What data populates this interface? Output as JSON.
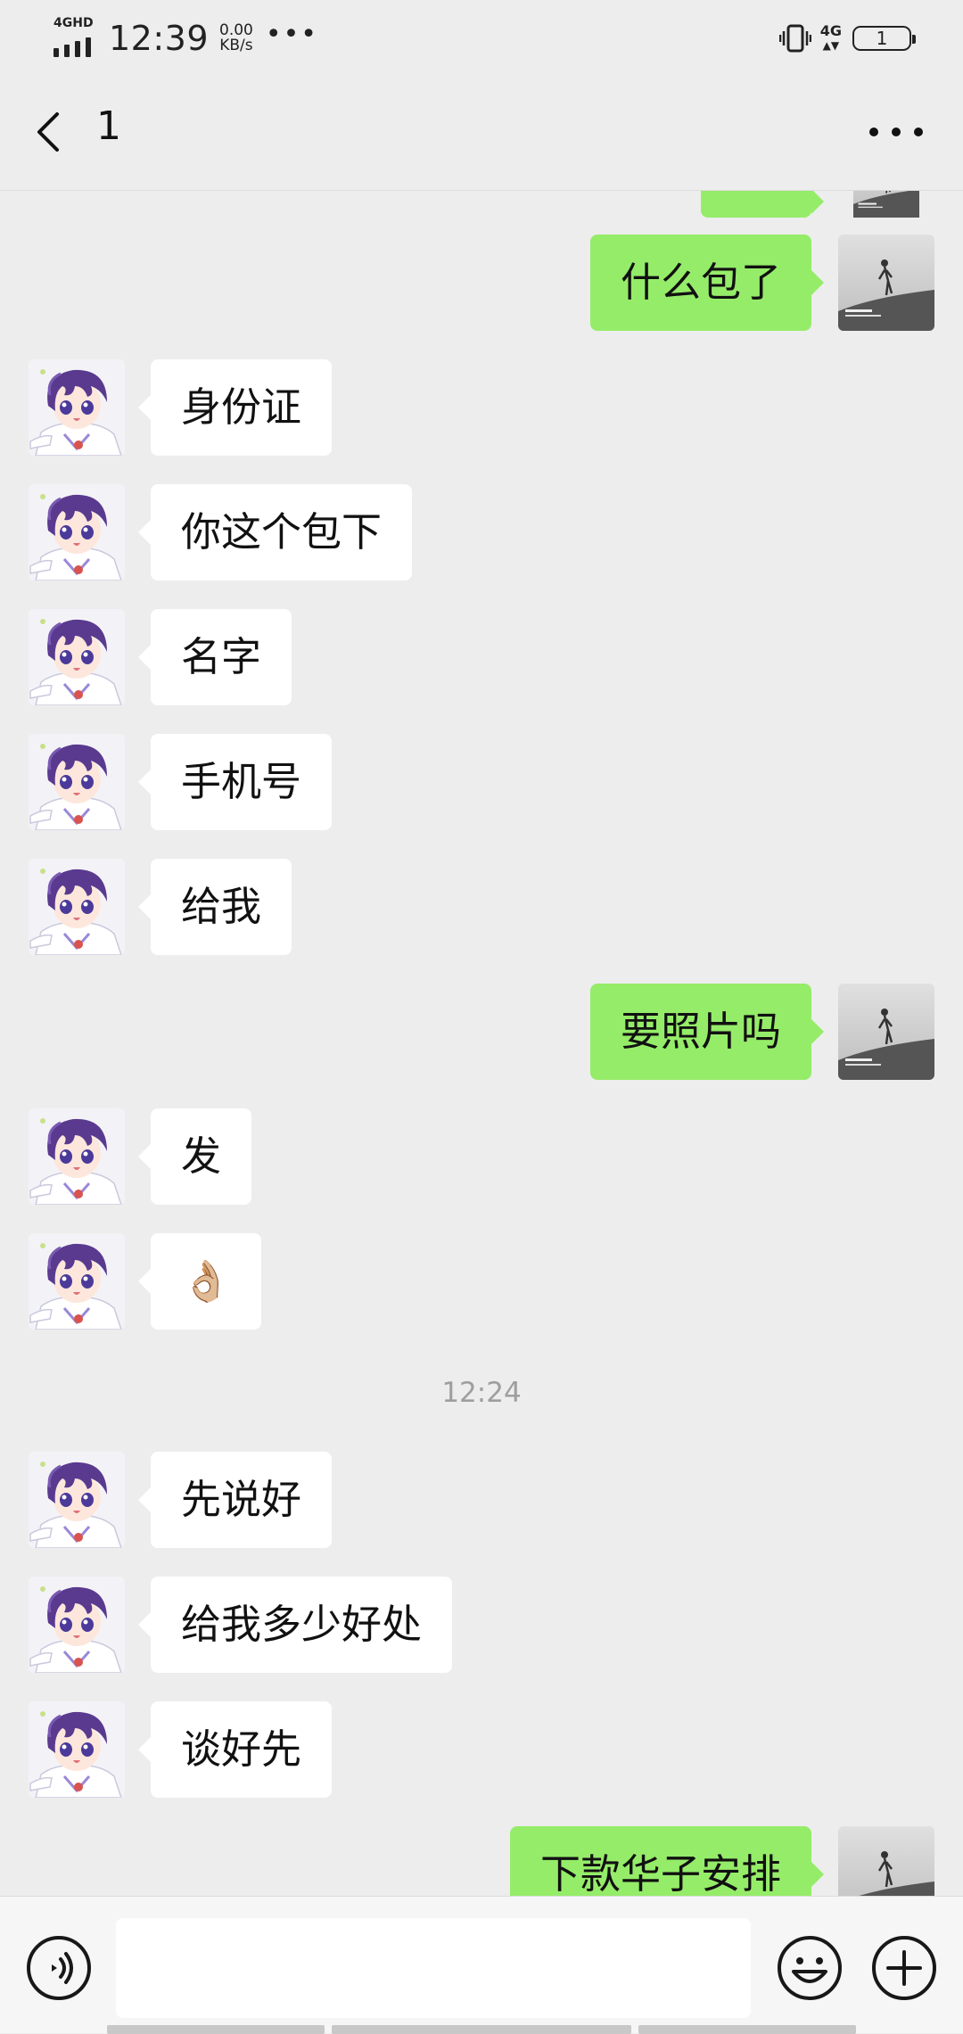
{
  "status_bar": {
    "network_tag": "4GHD",
    "time": "12:39",
    "speed_value": "0.00",
    "speed_unit": "KB/s",
    "overflow": "•••",
    "network_right": "4G",
    "battery": "1"
  },
  "header": {
    "title": "1",
    "back_icon": "chevron-left-icon",
    "more_icon": "more-dots-icon"
  },
  "messages": [
    {
      "side": "out",
      "text": "",
      "partial": true
    },
    {
      "side": "out",
      "text": "什么包了"
    },
    {
      "side": "in",
      "text": "身份证"
    },
    {
      "side": "in",
      "text": "你这个包下"
    },
    {
      "side": "in",
      "text": "名字"
    },
    {
      "side": "in",
      "text": "手机号"
    },
    {
      "side": "in",
      "text": "给我"
    },
    {
      "side": "out",
      "text": "要照片吗"
    },
    {
      "side": "in",
      "text": "发"
    },
    {
      "side": "in",
      "text": "👌🏼"
    },
    {
      "side": "in",
      "text": "先说好"
    },
    {
      "side": "in",
      "text": "给我多少好处"
    },
    {
      "side": "in",
      "text": "谈好先"
    },
    {
      "side": "out",
      "text": "下款华子安排"
    }
  ],
  "timestamp": "12:24",
  "input_bar": {
    "voice_icon": "voice-icon",
    "emoji_icon": "emoji-icon",
    "plus_icon": "plus-icon",
    "placeholder": ""
  },
  "colors": {
    "background": "#ededed",
    "bubble_out": "#95ec69",
    "bubble_in": "#ffffff",
    "timestamp": "#9e9e9e"
  }
}
